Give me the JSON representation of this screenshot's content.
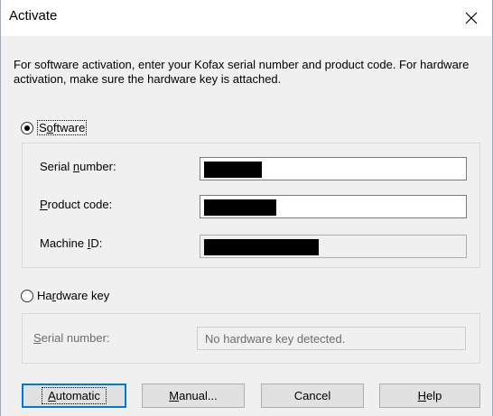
{
  "window": {
    "title": "Activate"
  },
  "description": "For software activation, enter your Kofax serial number and product code.  For hardware activation, make sure the hardware key is attached.",
  "software": {
    "label_prefix": "S",
    "label_underlined": "o",
    "label_suffix": "ftware",
    "selected": true,
    "serial_label_prefix": "Serial ",
    "serial_label_underlined": "n",
    "serial_label_suffix": "umber:",
    "product_label_underlined": "P",
    "product_label_suffix": "roduct code:",
    "machine_label_prefix": "Machine ",
    "machine_label_underlined": "I",
    "machine_label_suffix": "D:"
  },
  "hardware": {
    "label_prefix": "Ha",
    "label_underlined": "r",
    "label_suffix": "dware key",
    "selected": false,
    "serial_label_underlined": "S",
    "serial_label_suffix": "erial number:",
    "serial_value": "No hardware key detected."
  },
  "buttons": {
    "automatic_underlined": "A",
    "automatic_suffix": "utomatic",
    "manual_underlined": "M",
    "manual_suffix": "anual...",
    "cancel": "Cancel",
    "help_underlined": "H",
    "help_suffix": "elp"
  },
  "colors": {
    "accent": "#0078d7",
    "redaction": "#000000"
  }
}
